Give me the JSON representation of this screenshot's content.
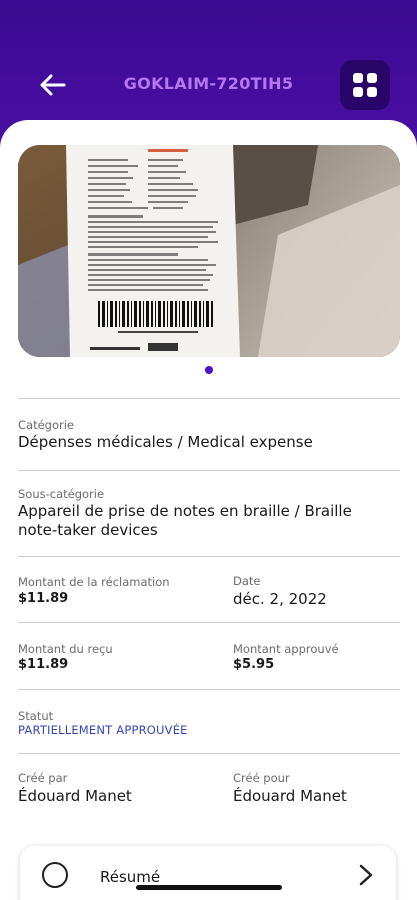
{
  "header": {
    "title": "GOKLAIM-720TIH5",
    "back_icon": "arrow-left-icon",
    "menu_icon": "grid-icon"
  },
  "details": {
    "categorie_label": "Catégorie",
    "categorie_value": "Dépenses médicales / Medical expense",
    "souscat_label": "Sous-catégorie",
    "souscat_value_line1": "Appareil de prise de notes en braille / Braille",
    "souscat_value_line2": "note-taker devices",
    "montant_reclamation_label": "Montant de la réclamation",
    "montant_reclamation_value": "$11.89",
    "date_label": "Date",
    "date_value": "déc. 2, 2022",
    "montant_recu_label": "Montant du reçu",
    "montant_recu_value": "$11.89",
    "montant_approuve_label": "Montant approuvé",
    "montant_approuve_value": "$5.95",
    "statut_label": "Statut",
    "statut_value": "PARTIELLEMENT APPROUVÉE",
    "cree_par_label": "Créé par",
    "cree_par_value": "Édouard  Manet",
    "cree_pour_label": "Créé pour",
    "cree_pour_value": "Édouard  Manet"
  },
  "summary": {
    "label": "Résumé"
  },
  "colors": {
    "header_bg": "#3c0a91",
    "title_color": "#b477f0",
    "status_color": "#3346b8",
    "dot_color": "#4b0fd6"
  }
}
